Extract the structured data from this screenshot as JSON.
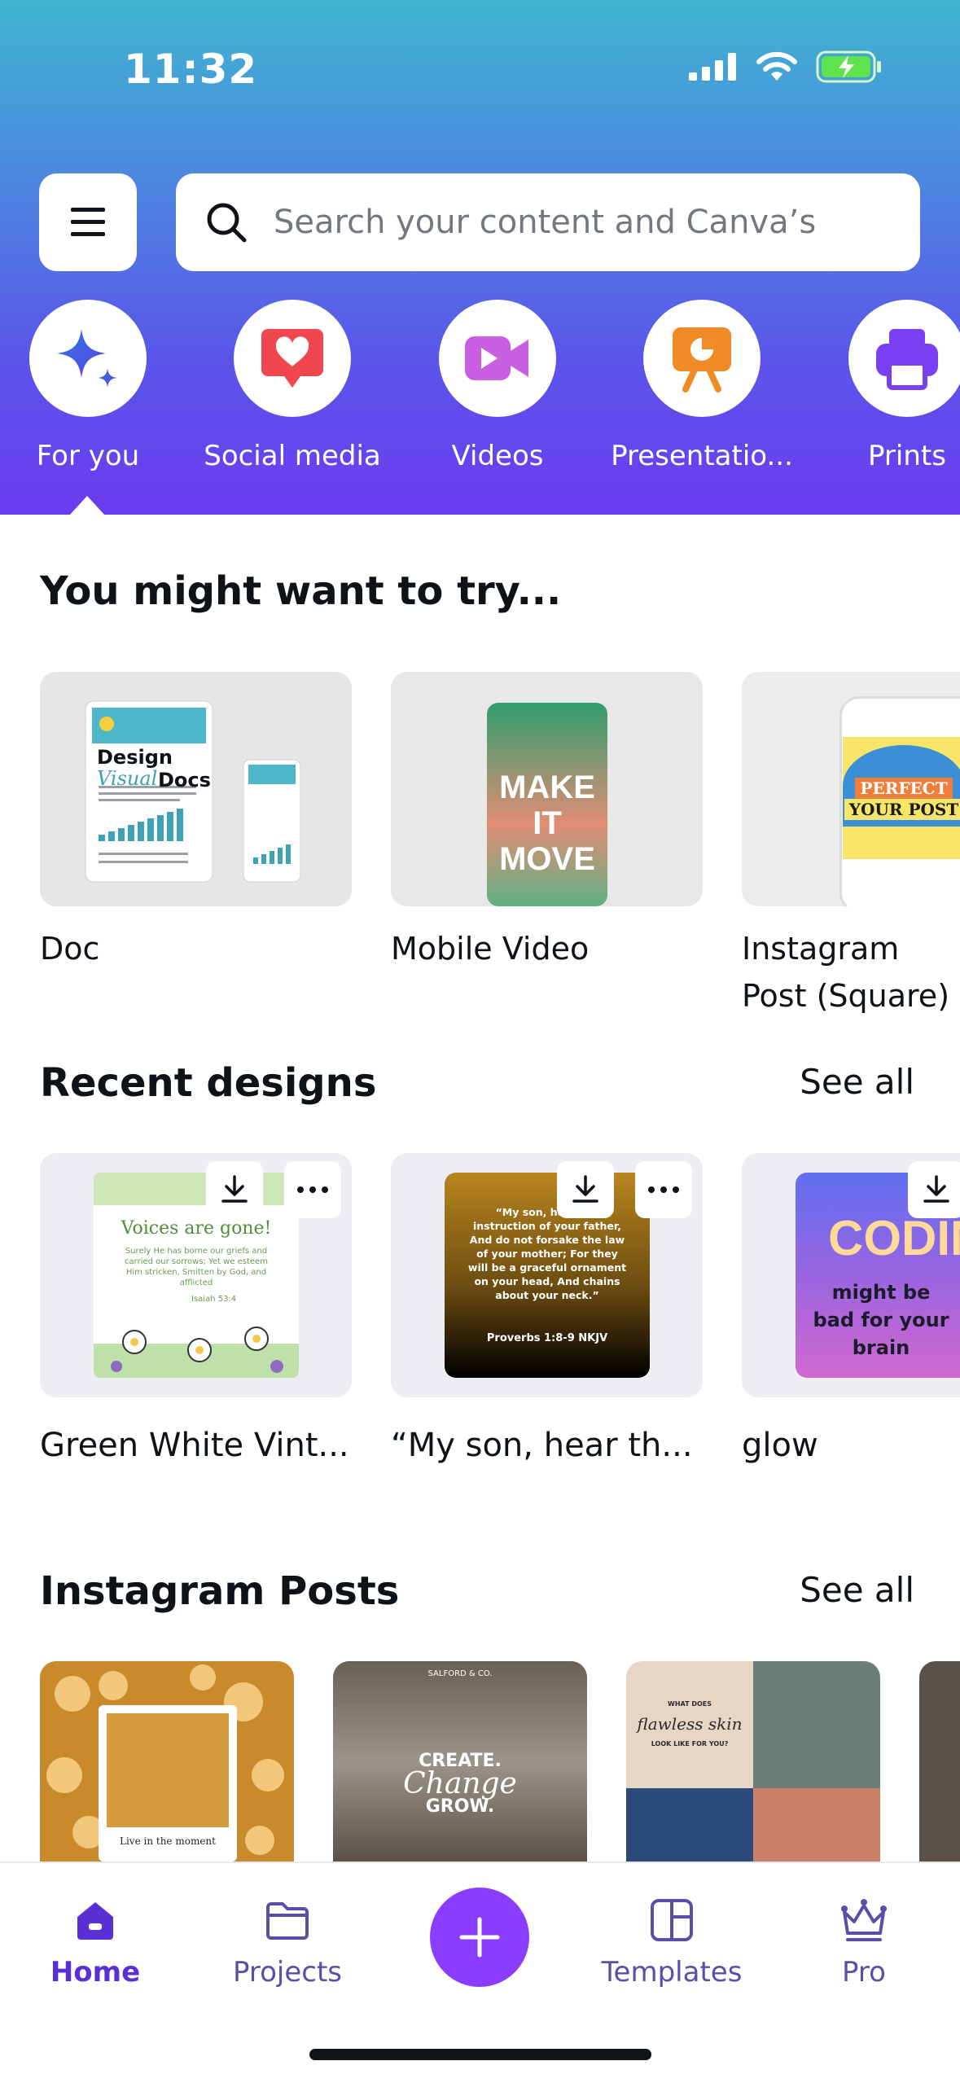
{
  "status": {
    "time": "11:32"
  },
  "search": {
    "placeholder": "Search your content and Canva’s"
  },
  "categories": [
    {
      "label": "For you",
      "icon": "sparkle-icon"
    },
    {
      "label": "Social media",
      "icon": "heart-chat-icon"
    },
    {
      "label": "Videos",
      "icon": "video-camera-icon"
    },
    {
      "label": "Presentatio...",
      "icon": "presentation-icon"
    },
    {
      "label": "Prints",
      "icon": "printer-icon"
    }
  ],
  "try_section": {
    "title": "You might want to try...",
    "items": [
      {
        "label": "Doc",
        "thumb": {
          "line1": "Design",
          "line2": "Visual",
          "line3": "Docs"
        }
      },
      {
        "label": "Mobile Video",
        "thumb": {
          "text": "MAKE IT MOVE"
        }
      },
      {
        "label": "Instagram Post (Square)",
        "thumb": {
          "line1": "PERFECT",
          "line2": "YOUR POST"
        }
      }
    ]
  },
  "recent": {
    "title": "Recent designs",
    "see_all": "See all",
    "items": [
      {
        "label": "Green White Vint...",
        "thumb": {
          "title": "Voices are gone!",
          "body": "Surely He has borne our griefs and carried our sorrows; Yet we esteem Him stricken, Smitten by God, and afflicted",
          "ref": "Isaiah 53:4"
        }
      },
      {
        "label": "“My son, hear th...",
        "thumb": {
          "body": "“My son, hear the instruction of your father, And do not forsake the law of your mother; For they will be a graceful ornament on your head, And chains about your neck.”",
          "ref": "Proverbs 1:8-9 NKJV"
        }
      },
      {
        "label": "glow",
        "thumb": {
          "title": "CODING",
          "body": "might be bad for your brain"
        }
      }
    ]
  },
  "instagram": {
    "title": "Instagram Posts",
    "see_all": "See all",
    "items": [
      {
        "caption": "Live in the moment"
      },
      {
        "brand": "SALFORD & CO.",
        "line1": "CREATE.",
        "line2": "Change",
        "line3": "GROW."
      },
      {
        "small1": "WHAT DOES",
        "script": "flawless skin",
        "small2": "LOOK LIKE FOR YOU?"
      }
    ]
  },
  "tabbar": {
    "tabs": [
      {
        "label": "Home",
        "icon": "home-icon",
        "active": true
      },
      {
        "label": "Projects",
        "icon": "folder-icon"
      },
      {
        "label": "Templates",
        "icon": "templates-icon"
      },
      {
        "label": "Pro",
        "icon": "crown-icon"
      }
    ]
  },
  "colors": {
    "brand": "#8b3dff",
    "active_tab": "#5b2fd6",
    "inactive_tab": "#5a4fa8"
  }
}
